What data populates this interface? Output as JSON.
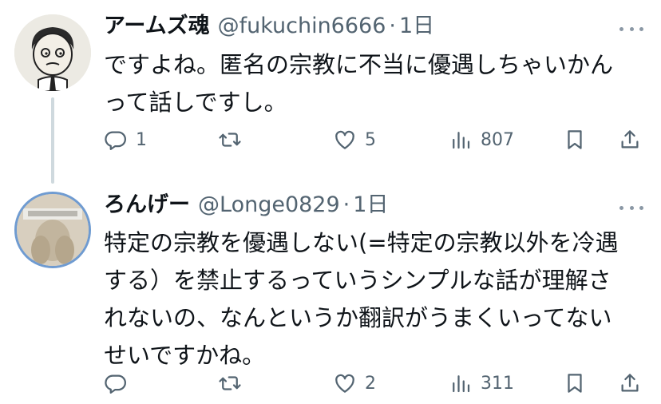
{
  "tweets": [
    {
      "display_name": "アームズ魂",
      "handle": "@fukuchin6666",
      "separator": "·",
      "time": "1日",
      "text": "ですよね。匿名の宗教に不当に優遇しちゃいかん\nって話しですし。",
      "replies": "1",
      "retweets": "",
      "likes": "5",
      "views": "807"
    },
    {
      "display_name": "ろんげー",
      "handle": "@Longe0829",
      "separator": "·",
      "time": "1日",
      "text": "特定の宗教を優遇しない(=特定の宗教以外を冷遇\nする）を禁止するっていうシンプルな話が理解さ\nれないの、なんというか翻訳がうまくいってない\nせいですかね。",
      "replies": "",
      "retweets": "",
      "likes": "2",
      "views": "311"
    }
  ],
  "icons": {
    "reply": "reply-icon",
    "retweet": "retweet-icon",
    "like": "heart-icon",
    "views": "views-chart-icon",
    "bookmark": "bookmark-icon",
    "share": "share-icon",
    "more": "more-dots-icon"
  },
  "colors": {
    "text": "#0f1419",
    "secondary": "#536471",
    "thread_line": "#cfd9de",
    "avatar_ring": "#6f9bd1"
  }
}
